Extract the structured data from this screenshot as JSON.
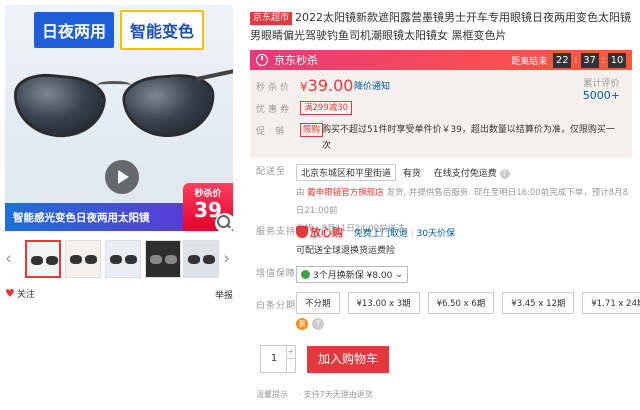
{
  "gallery": {
    "header_left": "日夜两用",
    "header_right": "智能变色",
    "banner_text": "智能感光变色日夜两用太阳镜",
    "flash_label": "秒杀价",
    "flash_price": "39",
    "thumbnail_count": 5,
    "follow_label": "关注",
    "report_label": "举报"
  },
  "product": {
    "store_tag": "京东超市",
    "title": "2022太阳镜新款遮阳露营墨镜男士开车专用眼镜日夜两用变色太阳镜男眼睛偏光驾驶钓鱼司机潮眼镜太阳镜女 黑框变色片"
  },
  "flash_sale": {
    "title": "京东秒杀",
    "countdown_label": "距离结束",
    "hours": "22",
    "minutes": "37",
    "seconds": "10"
  },
  "price": {
    "label": "秒杀价",
    "currency": "¥",
    "value": "39.00",
    "notify_label": "降价通知",
    "reviews_label": "累计评价",
    "reviews_count": "5000+"
  },
  "coupon": {
    "label": "优惠券",
    "text": "满299减30"
  },
  "promotion": {
    "label": "促销",
    "tag": "限购",
    "text": "购买不超过51件时享受单件价￥39，超出数量以结算价为准，仅限购买一次"
  },
  "delivery": {
    "label": "配送至",
    "address": "北京东城区和平里街道",
    "stock": "有货",
    "service": "在线支付免运费",
    "from_prefix": "由",
    "seller": "戴申眼镜官方旗舰店",
    "from_text": "发货, 并提供售后服务. 现在至明日16:00前完成下单，预计8月8日21:00前",
    "eta": "发货，8月11日24:00前送达"
  },
  "service": {
    "label": "服务支持",
    "brand": "放心购",
    "items": [
      "免费上门取退",
      "30天价保"
    ],
    "sub": "可配送全球退换货运费险"
  },
  "insurance": {
    "label": "增值保障",
    "selected": "3个月换新保 ¥8.00"
  },
  "installment": {
    "label": "白条分期",
    "options": [
      "不分期",
      "¥13.00 x 3期",
      "¥6.50 x 6期",
      "¥3.45 x 12期",
      "¥1.71 x 24期"
    ],
    "icon_text": "惠"
  },
  "cart": {
    "quantity": "1",
    "plus": "+",
    "minus": "-",
    "add_label": "加入购物车"
  },
  "tips": {
    "label": "温馨提示",
    "text": "· 支持7天无理由退货"
  }
}
